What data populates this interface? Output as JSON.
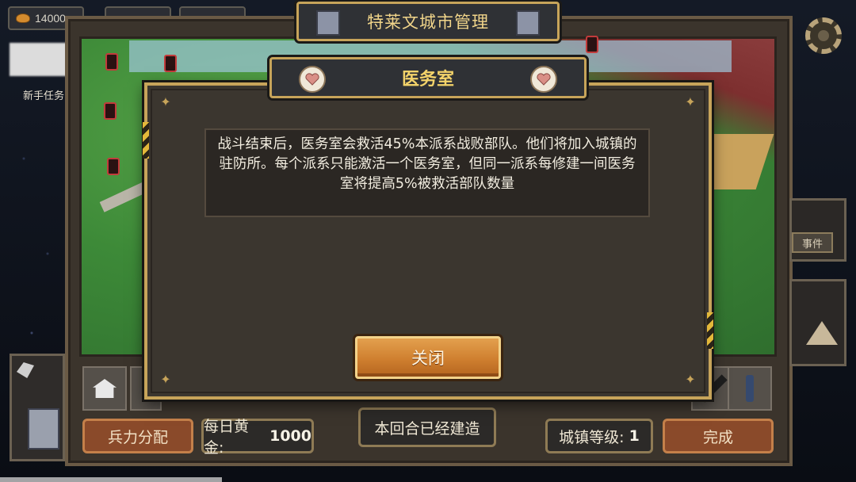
{
  "resources": {
    "gold_value": "14000"
  },
  "sidebar": {
    "quest_label": "新手任务"
  },
  "city": {
    "title": "特莱文城市管理"
  },
  "side_panel": {
    "event_label": "事件"
  },
  "bottom_bar": {
    "troop_allocation": "兵力分配",
    "daily_gold_label": "每日黄金:",
    "daily_gold_value": "1000",
    "built_status": "本回合已经建造",
    "town_level_label": "城镇等级:",
    "town_level_value": "1",
    "finish": "完成"
  },
  "modal": {
    "title": "医务室",
    "description": "战斗结束后，医务室会救活45%本派系战败部队。他们将加入城镇的驻防所。每个派系只能激活一个医务室，但同一派系每修建一间医务室将提高5%被救活部队数量",
    "close_label": "关闭",
    "title_icon": "heart-icon"
  },
  "colors": {
    "accent_gold": "#c7a45a",
    "title_text": "#f3d36a",
    "close_button": "#d98a3c"
  }
}
